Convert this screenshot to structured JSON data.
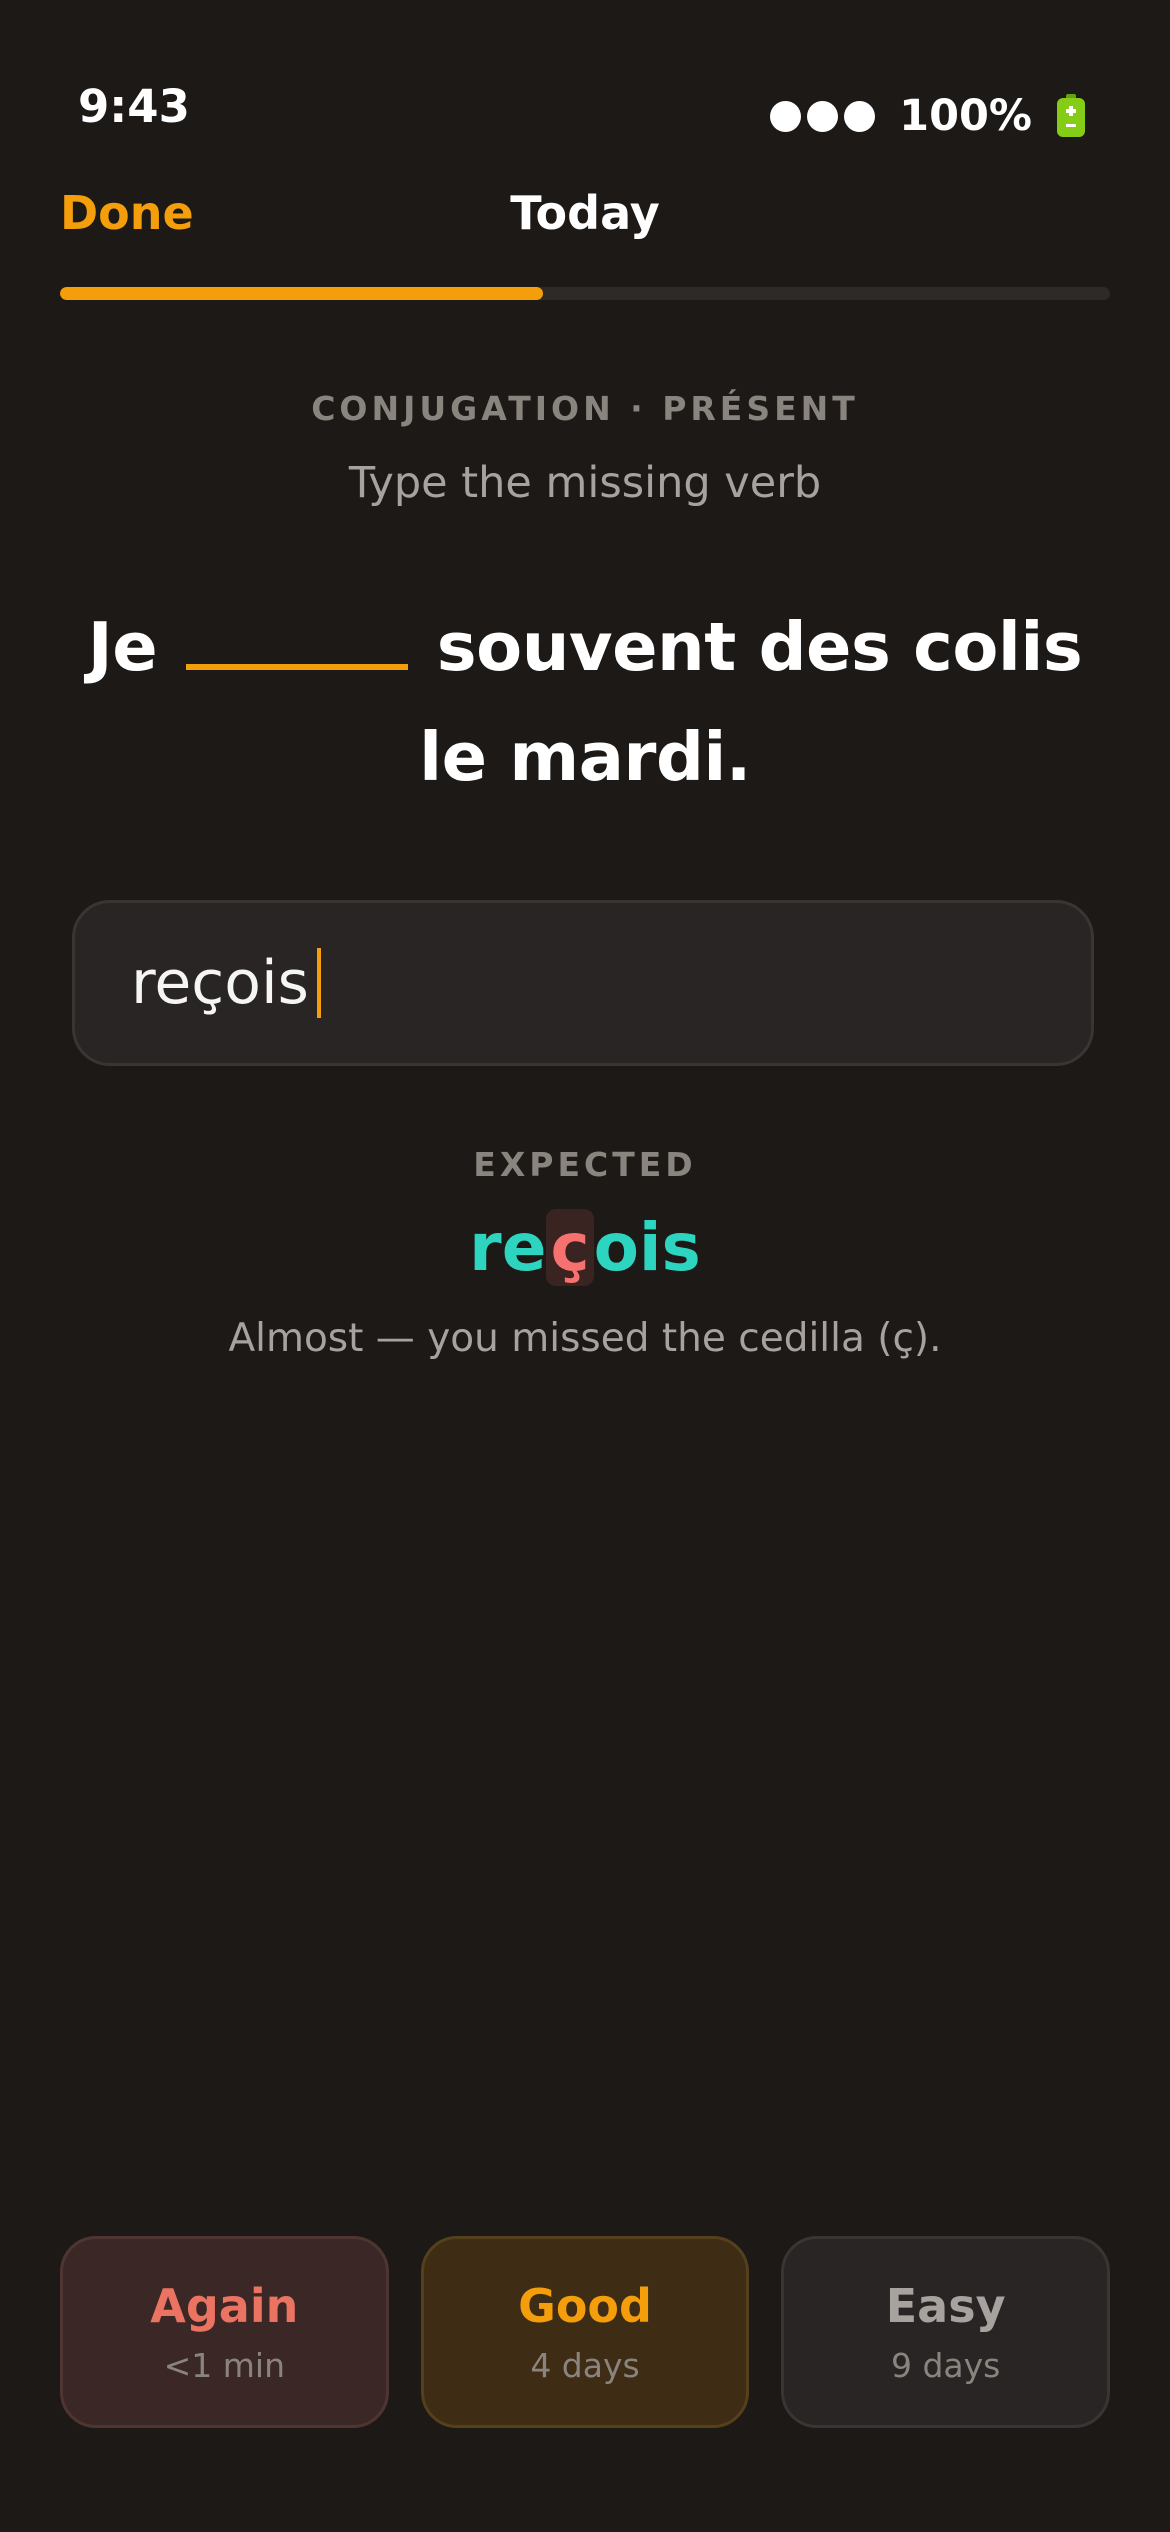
{
  "status_bar": {
    "time": "9:43",
    "battery_percent": "100%",
    "signal_icon": "signal-dots-icon",
    "battery_icon": "battery-icon"
  },
  "nav": {
    "done_label": "Done",
    "title": "Today"
  },
  "progress": {
    "fraction": 0.46,
    "color": "#f59e0b"
  },
  "card": {
    "eyebrow": "CONJUGATION · PRÉSENT",
    "instruction": "Type the missing verb",
    "sentence_before": "Je",
    "sentence_after": "souvent des colis le mardi."
  },
  "answer": {
    "value": "reçois"
  },
  "expected": {
    "label": "EXPECTED",
    "part_before": "re",
    "part_error": "ç",
    "part_after": "ois",
    "feedback": "Almost — you missed the cedilla (ç)."
  },
  "ratings": [
    {
      "label": "Again",
      "interval": "<1 min",
      "color": "#ea7362"
    },
    {
      "label": "Good",
      "interval": "4 days",
      "color": "#f59e0b"
    },
    {
      "label": "Easy",
      "interval": "9 days",
      "color": "#a8a29e"
    }
  ],
  "colors": {
    "background": "#1c1917",
    "accent": "#f59e0b",
    "correct": "#2dd4bf",
    "error": "#f87171"
  }
}
